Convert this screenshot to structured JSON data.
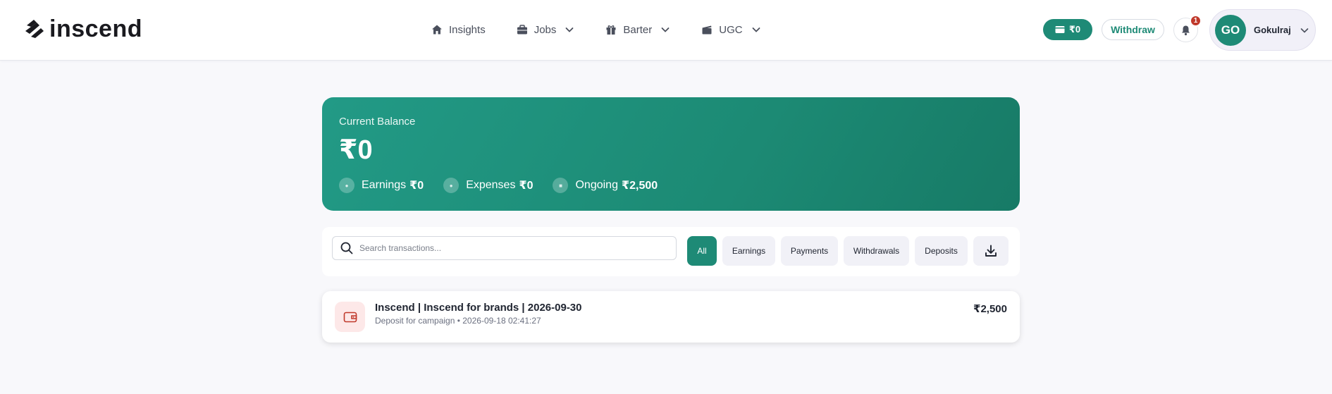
{
  "brand": {
    "name": "inscend"
  },
  "nav": [
    {
      "label": "Insights",
      "icon": "home-icon"
    },
    {
      "label": "Jobs",
      "icon": "briefcase-icon"
    },
    {
      "label": "Barter",
      "icon": "gift-icon"
    },
    {
      "label": "UGC",
      "icon": "clapperboard-icon"
    }
  ],
  "header": {
    "wallet_balance": "₹0",
    "withdraw_label": "Withdraw",
    "notification_count": "1",
    "user_initials": "GO",
    "user_name": "Gokulraj"
  },
  "balance": {
    "label": "Current Balance",
    "value": "₹0",
    "stats": [
      {
        "label": "Earnings",
        "value": "₹0"
      },
      {
        "label": "Expenses",
        "value": "₹0"
      },
      {
        "label": "Ongoing",
        "value": "₹2,500"
      }
    ]
  },
  "filters": {
    "search_placeholder": "Search transactions...",
    "chips": [
      "All",
      "Earnings",
      "Payments",
      "Withdrawals",
      "Deposits"
    ],
    "active": "All"
  },
  "transactions": [
    {
      "title": "Inscend | Inscend for brands | 2026-09-30",
      "subtitle": "Deposit for campaign • 2026-09-18 02:41:27",
      "amount": "₹2,500"
    }
  ],
  "colors": {
    "accent": "#1e8a76",
    "badge": "#c0392b",
    "txn_icon_bg": "#fde8e8"
  }
}
